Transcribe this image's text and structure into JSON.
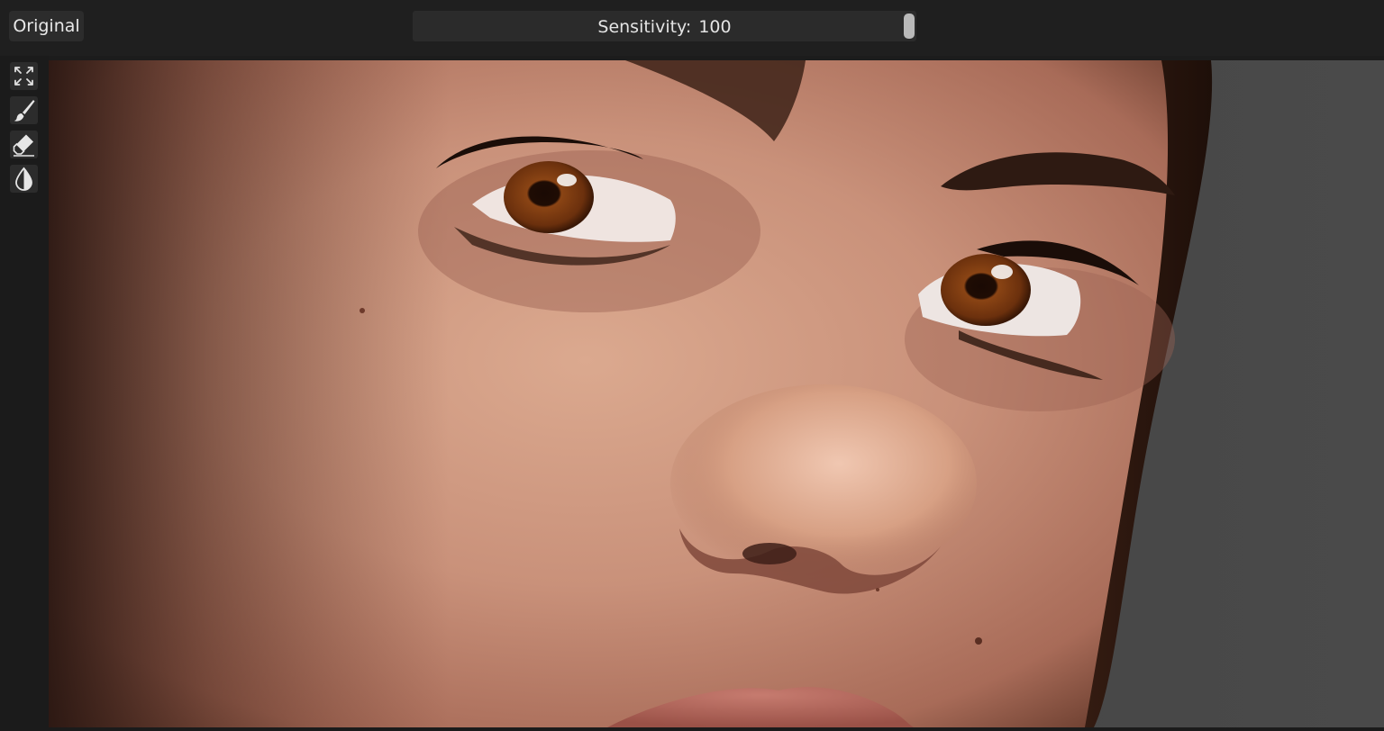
{
  "header": {
    "original_label": "Original",
    "slider": {
      "label": "Sensitivity:",
      "value": "100",
      "handle_position_fraction": 0.985
    }
  },
  "toolbar": {
    "tools": [
      {
        "icon": "fit-to-screen-icon"
      },
      {
        "icon": "brush-icon"
      },
      {
        "icon": "eraser-icon"
      },
      {
        "icon": "opacity-contrast-icon"
      }
    ]
  },
  "canvas": {
    "content": "close-up portrait photo"
  },
  "colors": {
    "app_background": "#1c1c1c",
    "button_background": "#2c2c2c",
    "slider_handle": "#b9b9b9",
    "skin_tone": "#c8937c",
    "iris": "#7a3b12"
  }
}
